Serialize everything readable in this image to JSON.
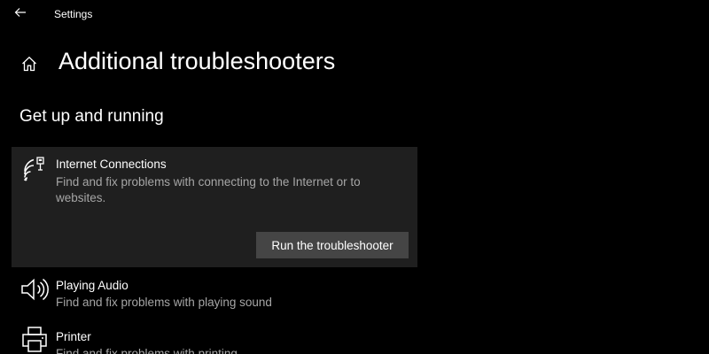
{
  "window": {
    "title": "Settings",
    "back_icon": "back-arrow-icon"
  },
  "header": {
    "home_icon": "home-icon",
    "title": "Additional troubleshooters"
  },
  "section": {
    "title": "Get up and running"
  },
  "troubleshooters": [
    {
      "icon": "wifi-ethernet-icon",
      "name": "Internet Connections",
      "description": "Find and fix problems with connecting to the Internet or to websites.",
      "selected": true,
      "run_button_label": "Run the troubleshooter"
    },
    {
      "icon": "speaker-icon",
      "name": "Playing Audio",
      "description": "Find and fix problems with playing sound",
      "selected": false
    },
    {
      "icon": "printer-icon",
      "name": "Printer",
      "description": "Find and fix problems with printing",
      "selected": false
    }
  ],
  "colors": {
    "background": "#000000",
    "card_selected": "#1f1f1f",
    "button": "#454545",
    "text_primary": "#ffffff",
    "text_secondary": "#a6a6a6"
  }
}
